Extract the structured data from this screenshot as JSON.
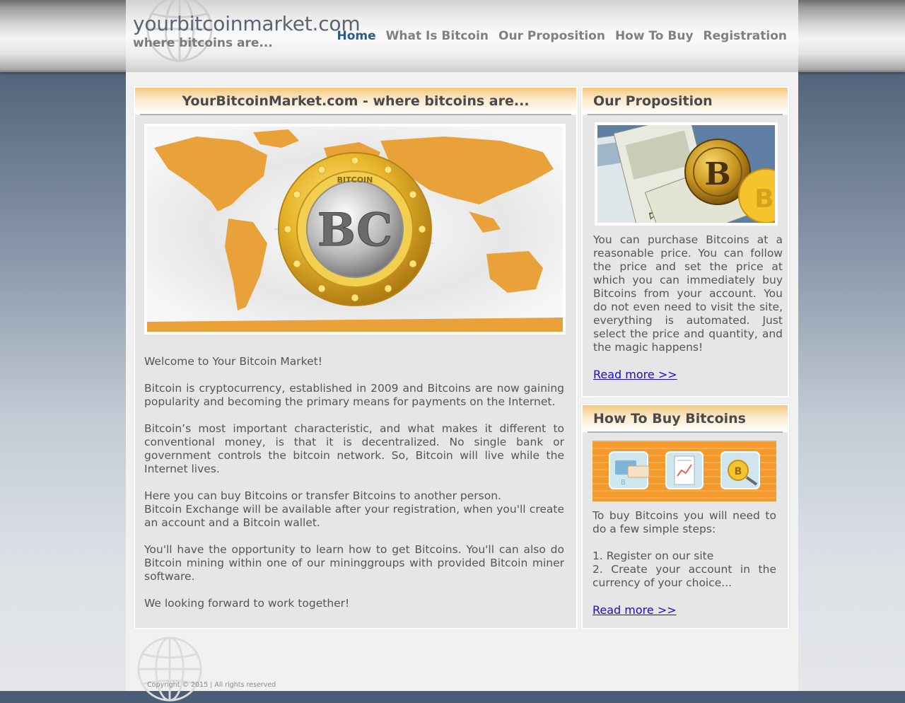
{
  "header": {
    "logo": "yourbitcoinmarket.com",
    "tagline": "where bitcoins are..."
  },
  "nav": {
    "items": [
      {
        "label": "Home",
        "active": true
      },
      {
        "label": "What Is Bitcoin",
        "active": false
      },
      {
        "label": "Our Proposition",
        "active": false
      },
      {
        "label": "How To Buy",
        "active": false
      },
      {
        "label": "Registration",
        "active": false
      }
    ]
  },
  "main": {
    "title": "YourBitcoinMarket.com - where bitcoins are...",
    "image_label": "BC",
    "image_ring": "BITCOIN",
    "paragraphs": [
      "Welcome to Your Bitcoin Market!",
      "Bitcoin is cryptocurrency, established in 2009 and Bitcoins are now gaining popularity and becoming the primary means for payments on the Internet.",
      "Bitcoin’s most important characteristic, and what makes it different to conventional money, is that it is decentralized. No single bank or government controls the bitcoin network. So, Bitcoin will live while the Internet lives.",
      "Here you can buy Bitcoins or transfer Bitcoins to another person.",
      "Bitcoin Exchange will be available after your registration, when you'll create an account and a Bitcoin wallet.",
      "You'll have the opportunity to learn how to get Bitcoins. You'll can also do Bitcoin mining within one of our mininggroups with provided Bitcoin miner software.",
      "We looking forward to work together!"
    ]
  },
  "proposition": {
    "title": "Our Proposition",
    "text": "You can purchase Bitcoins at a reasonable price. You can follow the price and set the price at which you can immediately buy Bitcoins from your account. You do not even need to visit the site, everything is automated. Just select the price and quantity, and the magic happens!",
    "read_more": "Read more >>"
  },
  "how_to_buy": {
    "title": "How To Buy Bitcoins",
    "intro": "To buy Bitcoins you will need to do a few simple steps:",
    "step1": "1. Register on our site",
    "step2": "2. Create your account in the currency of your choice...",
    "read_more": "Read more >>"
  },
  "footer": {
    "copyright": "Copyright © 2015  |  All rights reserved"
  },
  "colors": {
    "accent_nav": "#2c5a8c",
    "panel_header": "#f2c87c",
    "link": "#1a0dcc",
    "map_orange": "#e9a23a",
    "coin_gold": "#e7b52a"
  }
}
